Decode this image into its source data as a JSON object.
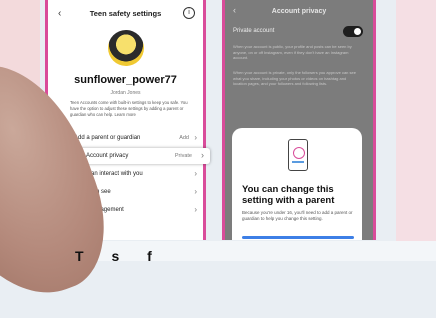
{
  "left_screen": {
    "header_title": "Teen safety settings",
    "back_glyph": "‹",
    "info_glyph": "i",
    "username": "sunflower_power77",
    "real_name": "Jordan Jones",
    "description": "Teen Accounts come with built-in settings to keep you safe. You have the option to adjust these settings by adding a parent or guardian who can help. Learn more",
    "menu": [
      {
        "label": "Add a parent or guardian",
        "value": "Add",
        "icon": "person-icon"
      },
      {
        "label": "Account privacy",
        "value": "Private",
        "icon": "lock-icon"
      },
      {
        "label": "Who can interact with you",
        "value": "",
        "icon": "chat-icon"
      },
      {
        "label": "What you see",
        "value": "",
        "icon": "eye-icon"
      },
      {
        "label": "Time management",
        "value": "",
        "icon": "clock-icon"
      }
    ]
  },
  "right_screen": {
    "header_title": "Account privacy",
    "back_glyph": "‹",
    "private_account_label": "Private account",
    "text_1": "When your account is public, your profile and posts can be seen by anyone, on or off Instagram, even if they don't have an Instagram account.",
    "text_2": "When your account is private, only the followers you approve can see what you share, including your photos or videos on hashtag and location pages, and your followers and following lists.",
    "sheet_title": "You can change this setting with a parent",
    "sheet_body": "Because you're under 16, you'll need to add a parent or guardian to help you change this setting."
  },
  "bottom_text": "T s f",
  "colors": {
    "frame_accent": "#d94c9a",
    "button_blue": "#3d7fe6"
  }
}
